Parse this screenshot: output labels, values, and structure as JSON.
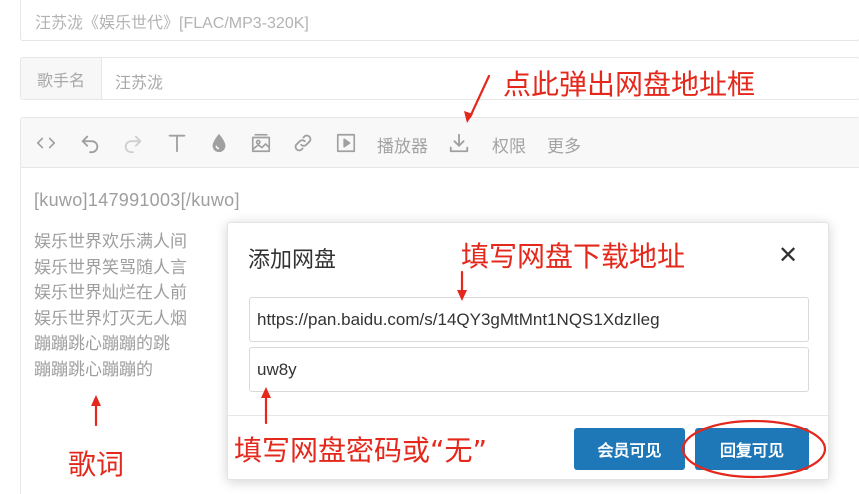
{
  "title_field": {
    "value": "汪苏泷《娱乐世代》[FLAC/MP3-320K]"
  },
  "singer": {
    "label": "歌手名",
    "value": "汪苏泷"
  },
  "toolbar": {
    "player_label": "播放器",
    "permission_label": "权限",
    "more_label": "更多"
  },
  "editor": {
    "tag": "[kuwo]147991003[/kuwo]",
    "lyrics": [
      "娱乐世界欢乐满人间",
      "娱乐世界笑骂随人言",
      "娱乐世界灿烂在人前",
      "娱乐世界灯灭无人烟",
      "蹦蹦跳心蹦蹦的跳",
      "蹦蹦跳心蹦蹦的"
    ]
  },
  "modal": {
    "title": "添加网盘",
    "close": "✕",
    "url_value": "https://pan.baidu.com/s/14QY3gMtMnt1NQS1XdzIleg",
    "password_value": "uw8y",
    "member_button": "会员可见",
    "reply_button": "回复可见"
  },
  "annotations": {
    "click_here": "点此弹出网盘地址框",
    "fill_url": "填写网盘下载地址",
    "fill_password": "填写网盘密码或“无”",
    "lyrics": "歌词",
    "color": "#e4281c"
  },
  "colors": {
    "accent": "#1e78b8",
    "annotation": "#e4281c"
  }
}
